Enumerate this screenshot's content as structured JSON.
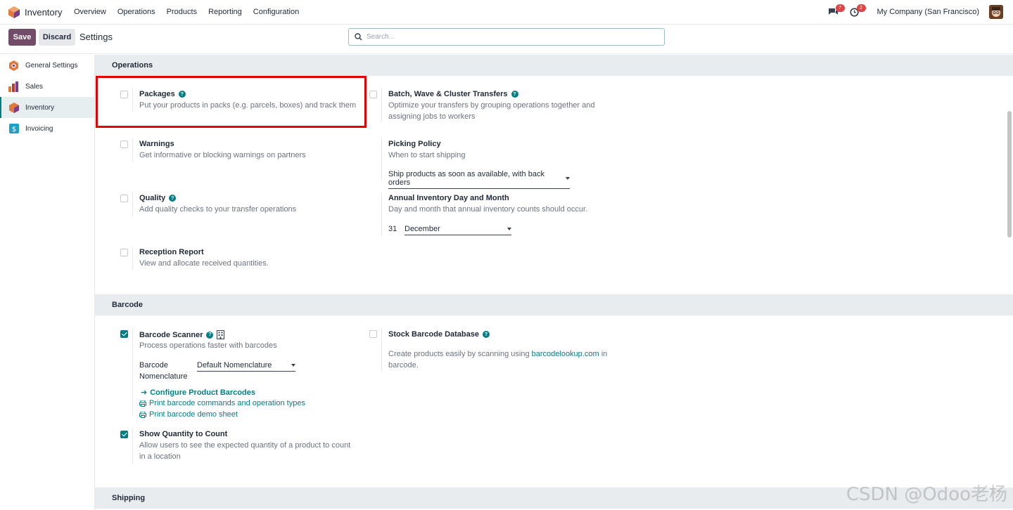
{
  "navbar": {
    "app_name": "Inventory",
    "menu": [
      "Overview",
      "Operations",
      "Products",
      "Reporting",
      "Configuration"
    ],
    "messages_count": "7",
    "activities_count": "2",
    "company": "My Company (San Francisco)"
  },
  "control": {
    "save_label": "Save",
    "discard_label": "Discard",
    "title": "Settings",
    "search_placeholder": "Search..."
  },
  "sidebar": {
    "items": [
      {
        "label": "General Settings",
        "icon": "odoo-settings-icon"
      },
      {
        "label": "Sales",
        "icon": "sales-chart-icon"
      },
      {
        "label": "Inventory",
        "icon": "inventory-box-icon",
        "active": true
      },
      {
        "label": "Invoicing",
        "icon": "invoicing-icon"
      }
    ]
  },
  "operations": {
    "header": "Operations",
    "packages": {
      "title": "Packages",
      "desc": "Put your products in packs (e.g. parcels, boxes) and track them",
      "checked": false
    },
    "batch": {
      "title": "Batch, Wave & Cluster Transfers",
      "desc1": "Optimize your transfers by grouping operations together and",
      "desc2": "assigning jobs to workers",
      "checked": false
    },
    "warnings": {
      "title": "Warnings",
      "desc": "Get informative or blocking warnings on partners",
      "checked": false
    },
    "picking": {
      "title": "Picking Policy",
      "desc": "When to start shipping",
      "value": "Ship products as soon as available, with back orders"
    },
    "quality": {
      "title": "Quality",
      "desc": "Add quality checks to your transfer operations",
      "checked": false
    },
    "annual": {
      "title": "Annual Inventory Day and Month",
      "desc": "Day and month that annual inventory counts should occur.",
      "day": "31",
      "month": "December"
    },
    "reception": {
      "title": "Reception Report",
      "desc": "View and allocate received quantities.",
      "checked": false
    }
  },
  "barcode": {
    "header": "Barcode",
    "scanner": {
      "title": "Barcode Scanner",
      "desc": "Process operations faster with barcodes",
      "checked": true,
      "nomenclature_label1": "Barcode",
      "nomenclature_label2": "Nomenclature",
      "nomenclature_value": "Default Nomenclature",
      "link_configure": "Configure Product Barcodes",
      "link_print_commands": "Print barcode commands and operation types",
      "link_print_demo": "Print barcode demo sheet"
    },
    "stock_db": {
      "title": "Stock Barcode Database",
      "desc_prefix": "Create products easily by scanning using",
      "desc_link": "barcodelookup.com",
      "desc_suffix": "in",
      "desc_line2": "barcode.",
      "checked": false
    },
    "show_qty": {
      "title": "Show Quantity to Count",
      "desc1": "Allow users to see the expected quantity of a product to count",
      "desc2": "in a location",
      "checked": true
    }
  },
  "shipping": {
    "header": "Shipping"
  },
  "watermark": "CSDN @Odoo老杨",
  "colors": {
    "brand": "#714b67",
    "accent": "#017e84",
    "highlight": "#e60000"
  }
}
